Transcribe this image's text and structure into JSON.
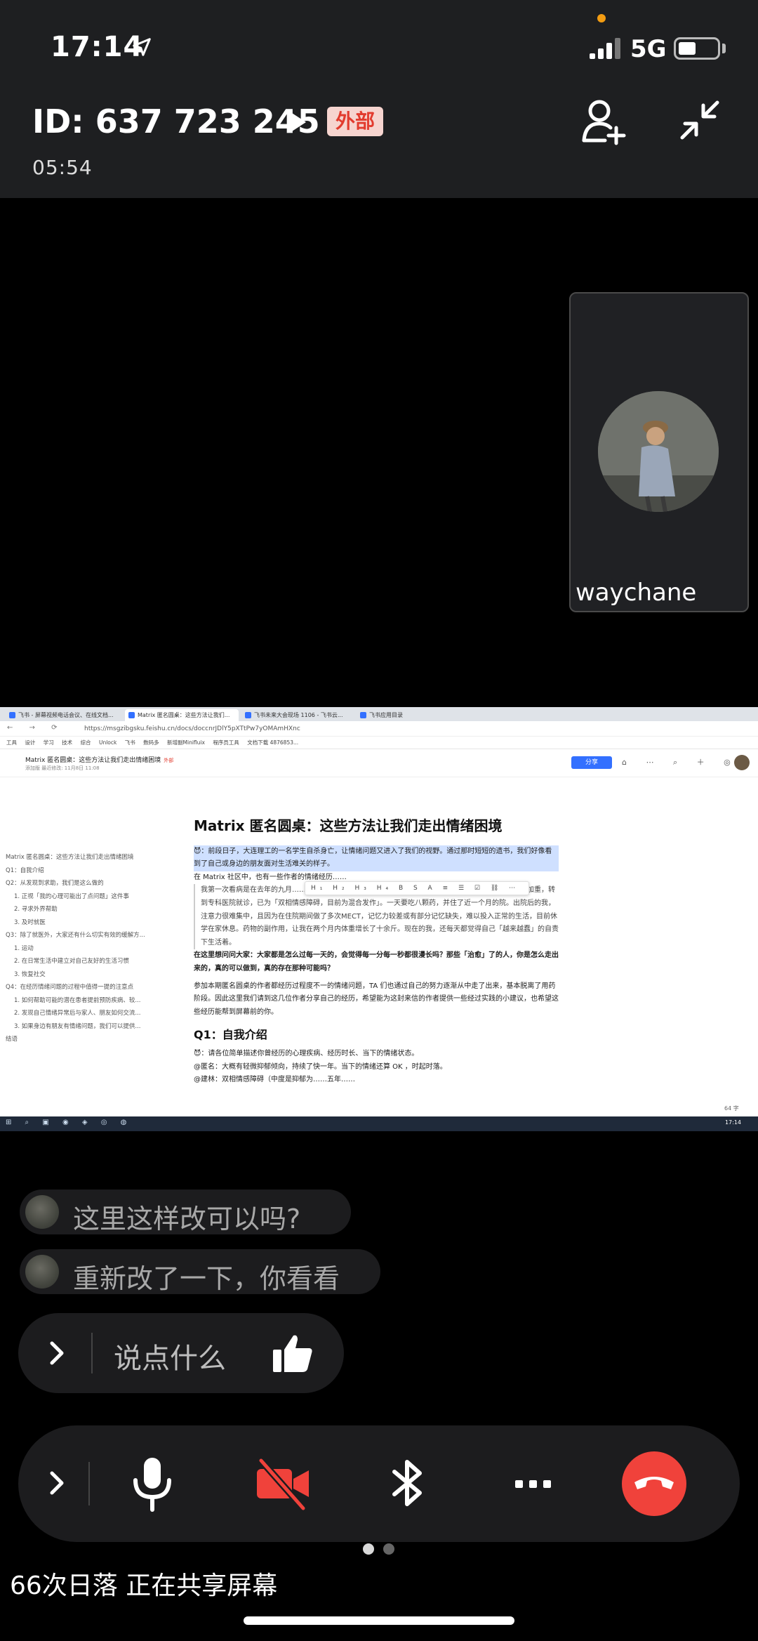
{
  "status_bar": {
    "time": "17:14",
    "network": "5G"
  },
  "meeting": {
    "id": "ID: 637 723 245",
    "badge": "外部",
    "timer": "05:54"
  },
  "participant": {
    "name": "waychane"
  },
  "shared_screen": {
    "tabs": [
      "飞书 - 屏幕视频电话会议、在线文档...",
      "Matrix 匿名圆桌：这些方法让我们...",
      "飞书未来大会现场 1106 - 飞书云...",
      "飞书应用目录"
    ],
    "url": "https://msgzibgsku.feishu.cn/docs/doccnrJDlY5pXTtPw7yOMAmHXnc",
    "bookmarks": [
      "工具",
      "设计",
      "学习",
      "技术",
      "综合",
      "Unlock",
      "飞书",
      "数码多",
      "新增副Minifluix",
      "程序员工具",
      "文档下载 4876853..."
    ],
    "doc_title": "Matrix 匿名圆桌：这些方法让我们走出情绪困境",
    "doc_tag": "外部",
    "doc_subtitle": "添加版   最近修改: 11月8日 11:08",
    "share_label": "分享",
    "toc": [
      {
        "text": "Matrix 匿名圆桌：这些方法让我们走出情绪困境",
        "sub": false
      },
      {
        "text": "Q1：自我介绍",
        "sub": false
      },
      {
        "text": "Q2：从发现到求助，我们是这么做的",
        "sub": false
      },
      {
        "text": "1. 正视「我的心理可能出了点问题」这件事",
        "sub": true
      },
      {
        "text": "2. 寻求外界帮助",
        "sub": true
      },
      {
        "text": "3. 及时就医",
        "sub": true
      },
      {
        "text": "Q3：除了就医外，大家还有什么切实有效的缓解方...",
        "sub": false
      },
      {
        "text": "1. 运动",
        "sub": true
      },
      {
        "text": "2. 在日常生活中建立对自己友好的生活习惯",
        "sub": true
      },
      {
        "text": "3. 恢复社交",
        "sub": true
      },
      {
        "text": "Q4：在经历情绪问题的过程中值得一提的注意点",
        "sub": false
      },
      {
        "text": "1. 如何帮助可能的潜在患者提前预防疾病、较...",
        "sub": true
      },
      {
        "text": "2. 发现自己情绪异常后与家人、朋友如何交流...",
        "sub": true
      },
      {
        "text": "3. 如果身边有朋友有情绪问题，我们可以提供...",
        "sub": true
      },
      {
        "text": "结语",
        "sub": false
      }
    ],
    "body": {
      "h1": "Matrix 匿名圆桌：这些方法让我们走出情绪困境",
      "p1": "😈：前段日子，大连理工的一名学生自杀身亡，让情绪问题又进入了我们的视野。通过那时短短的遗书，我们好像看到了自己或身边的朋友面对生活难关的样子。",
      "p2": "在 Matrix 社区中，也有一些作者的情绪经历……",
      "quote": "我第一次看病是在去年的九月……目前为不伴有精神病性症状的躁狂发作」。后来，家中变故使得病情再次加重，转到专科医院就诊，已为「双相情感障碍，目前为混合发作」。一天要吃八颗药，并住了近一个月的院。出院后的我，注意力很难集中，且因为在住院期间做了多次MECT，记忆力较差或有部分记忆缺失，难以投入正常的生活，目前休学在家休息。药物的副作用，让我在两个月内体重增长了十余斤。现在的我，还每天都觉得自己「越来越蠢」的自责下生活着。",
      "p3": "在这里想问问大家：大家都是怎么过每一天的，会觉得每一分每一秒都很漫长吗？那些「治愈」了的人，你是怎么走出来的，真的可以做到，真的存在那种可能吗？",
      "p4": "参加本期匿名圆桌的作者都经历过程度不一的情绪问题，TA 们也通过自己的努力逐渐从中走了出来，基本脱离了用药阶段。因此这里我们请到这几位作者分享自己的经历，希望能为这封来信的作者提供一些经过实践的小建议，也希望这些经历能帮到屏幕前的你。",
      "h2": "Q1：自我介绍",
      "p5": "😈：请各位简单描述你曾经历的心理疾病、经历时长、当下的情绪状态。",
      "p6": "@匿名：大概有轻微抑郁倾向，持续了快一年。当下的情绪还算 OK ，时起时落。",
      "p7": "@建林：双相情感障碍（中度是抑郁为……五年……"
    },
    "word_count": "64 字",
    "taskbar_time": "17:14"
  },
  "chat": {
    "messages": [
      "这里这样改可以吗?",
      "重新改了一下，你看看"
    ],
    "input_placeholder": "说点什么"
  },
  "footer": {
    "status_text": "66次日落 正在共享屏幕"
  },
  "colors": {
    "accent_red": "#f0423b",
    "badge_bg": "#f6d4cf",
    "badge_text": "#e23b2e",
    "share_blue": "#3370ff"
  }
}
